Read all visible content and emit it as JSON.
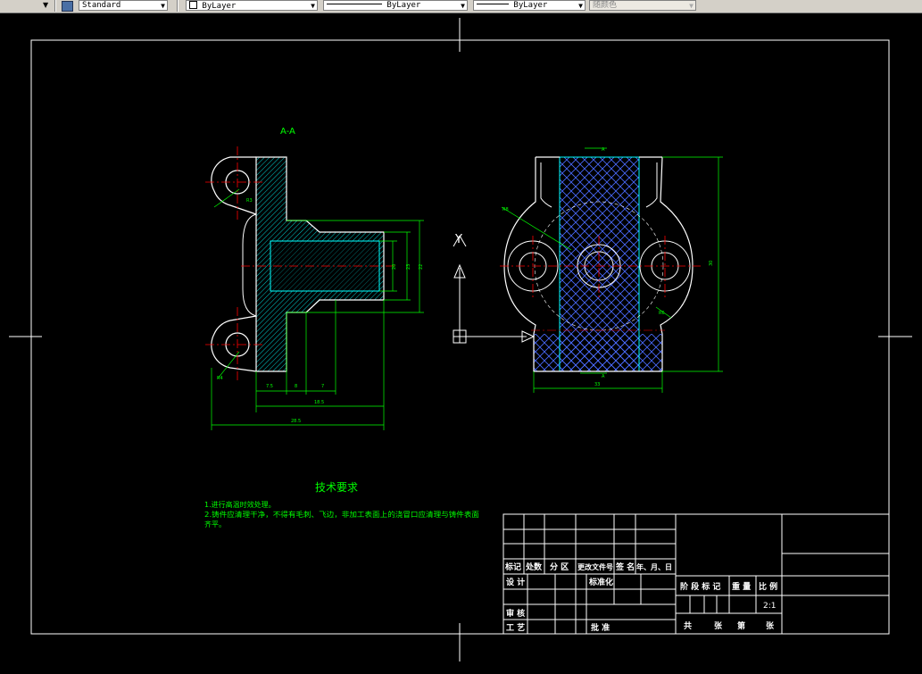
{
  "toolbar": {
    "text_style": "Standard",
    "layer": "ByLayer",
    "linetype": "ByLayer",
    "lineweight": "ByLayer",
    "color": "随颜色"
  },
  "drawing": {
    "section_label": "A-A",
    "view_label_y": "Y",
    "dimensions": {
      "d1": "7.5",
      "d2": "8",
      "d3": "7",
      "d4": "18.5",
      "d5": "28.5",
      "v1": "20",
      "v2": "23",
      "v3": "22",
      "v4": "3.5",
      "right_height": "30",
      "right_width": "33",
      "r_top": "R8",
      "r_small": "R3",
      "r_bottom": "R4",
      "r_right": "R6",
      "small_a": "A"
    }
  },
  "tech": {
    "title": "技术要求",
    "line1": "1.进行高温时效处理。",
    "line2": "2.铸件应清理干净，不得有毛刺、飞边，非加工表面上的浇冒口应清理与铸件表面",
    "line3": "齐平。"
  },
  "title_block": {
    "headers": [
      "标记",
      "处数",
      "分 区",
      "更改文件号",
      "签 名",
      "年、月、日"
    ],
    "design": "设 计",
    "standardize": "标准化",
    "stage_mark": "阶 段 标 记",
    "weight": "重 量",
    "scale": "比 例",
    "scale_value": "2:1",
    "review": "审 核",
    "process": "工 艺",
    "approve": "批 准",
    "sheets_total": "共",
    "sheets_unit": "张",
    "sheet_no": "第",
    "sheet_unit2": "张"
  },
  "colors": {
    "background": "#000000",
    "outline": "#ffffff",
    "part": "#00ffff",
    "hatch": "#4a6bff",
    "dimension": "#00ff00",
    "centerline": "#ff0000"
  }
}
